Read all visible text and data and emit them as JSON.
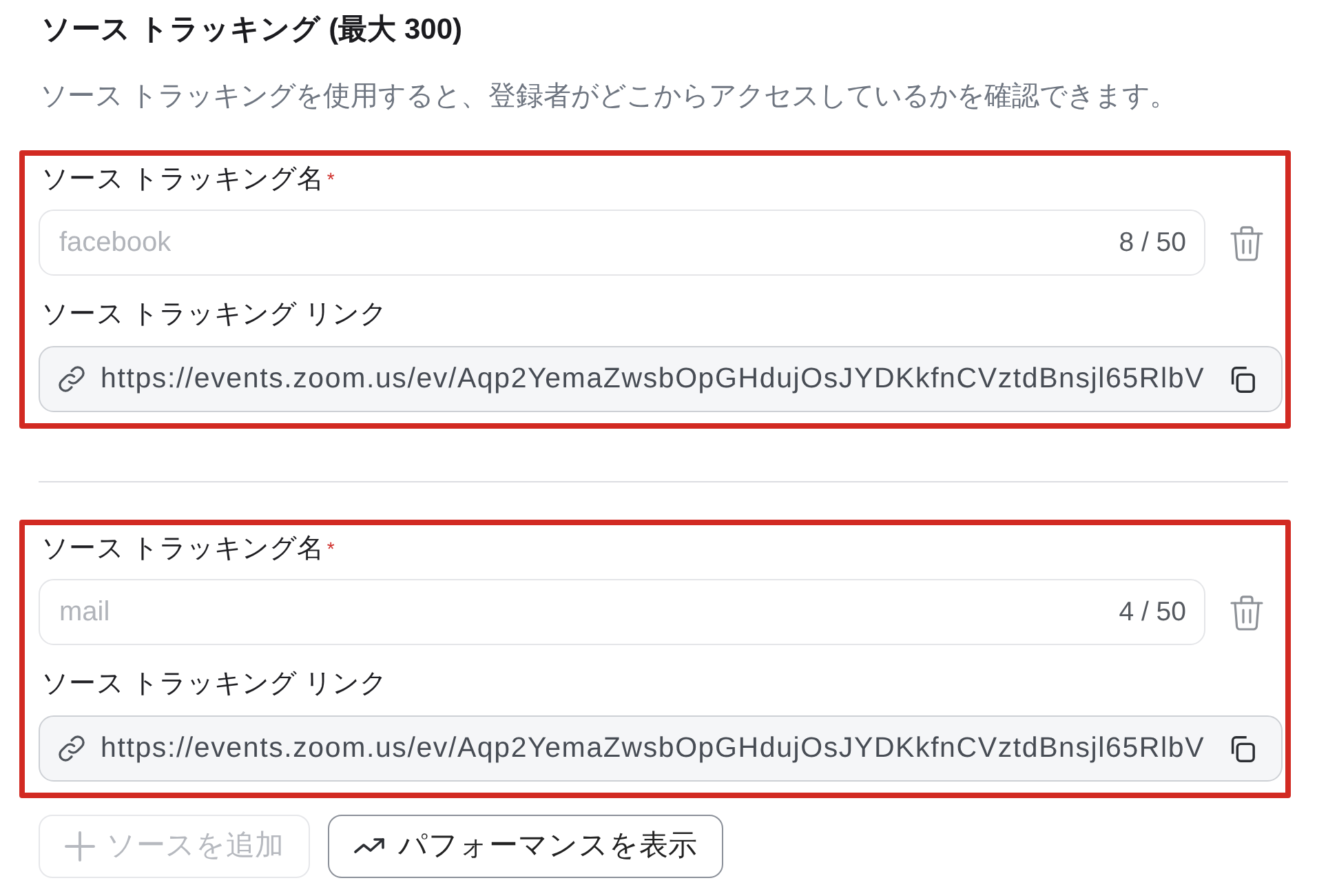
{
  "section": {
    "title": "ソース トラッキング (最大 300)",
    "description": "ソース トラッキングを使用すると、登録者がどこからアクセスしているかを確認できます。"
  },
  "entries": [
    {
      "highlighted": true,
      "name_label": "ソース トラッキング名",
      "required_mark": "*",
      "name_value": "facebook",
      "name_disabled": true,
      "counter": "8 / 50",
      "link_label": "ソース トラッキング リンク",
      "link_value": "https://events.zoom.us/ev/Aqp2YemaZwsbOpGHdujOsJYDKkfnCVztdBnsjl65RlbV"
    },
    {
      "highlighted": true,
      "name_label": "ソース トラッキング名",
      "required_mark": "*",
      "name_value": "mail",
      "name_disabled": true,
      "counter": "4 / 50",
      "link_label": "ソース トラッキング リンク",
      "link_value": "https://events.zoom.us/ev/Aqp2YemaZwsbOpGHdujOsJYDKkfnCVztdBnsjl65RlbV"
    }
  ],
  "buttons": [
    {
      "kind": "add",
      "label": "ソースを追加",
      "disabled": true
    },
    {
      "kind": "performance",
      "label": "パフォーマンスを表示",
      "disabled": false
    }
  ]
}
